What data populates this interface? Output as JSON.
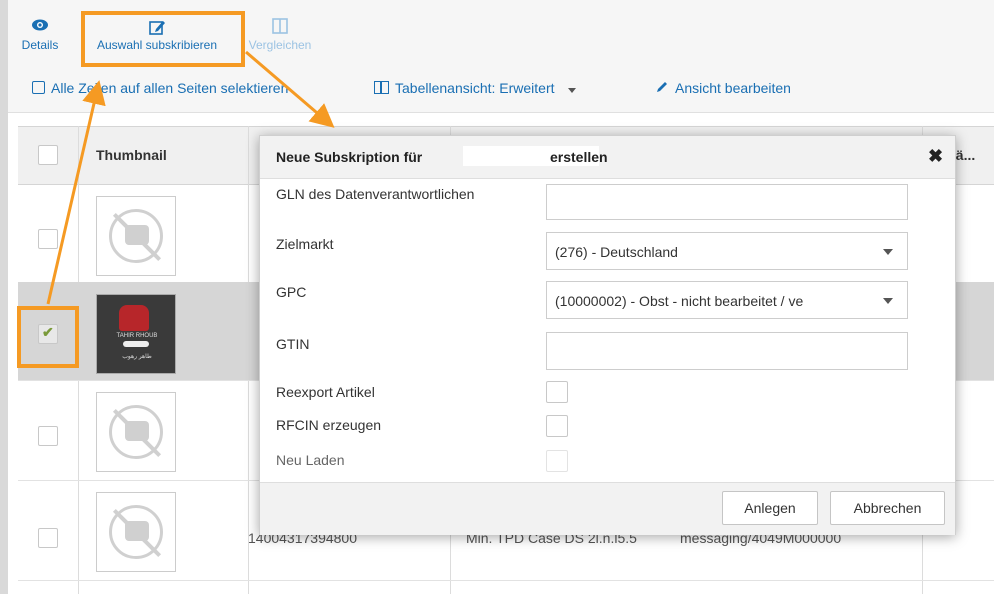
{
  "toolbar": {
    "details_label": "Details",
    "subscribe_label": "Auswahl subskribieren",
    "compare_label": "Vergleichen",
    "select_all_label": "Alle Zeilen auf allen Seiten selektieren",
    "table_view_label": "Tabellenansicht: Erweitert",
    "edit_view_label": "Ansicht bearbeiten"
  },
  "table": {
    "thumbnail_header": "Thumbnail",
    "last_header": "sä...",
    "row_partial": [
      "14004317394800",
      "Min. TPD Case DS 2l.n.l5.5",
      "messaging/4049M000000"
    ],
    "rows": [
      {
        "checked": false,
        "thumb": "placeholder"
      },
      {
        "checked": true,
        "thumb": "image",
        "thumb_text_1": "TAHIR RHOUB",
        "thumb_text_2": "طاهر رهوب"
      },
      {
        "checked": false,
        "thumb": "placeholder"
      },
      {
        "checked": false,
        "thumb": "placeholder"
      }
    ]
  },
  "dialog": {
    "title_prefix": "Neue Subskription für",
    "title_suffix": "erstellen",
    "close_symbol": "✖",
    "fields": {
      "gln_label": "GLN des Datenverantwortlichen",
      "gln_value": "",
      "target_market_label": "Zielmarkt",
      "target_market_value": "(276) - Deutschland",
      "gpc_label": "GPC",
      "gpc_value": "(10000002) - Obst - nicht bearbeitet / ve",
      "gtin_label": "GTIN",
      "gtin_value": "",
      "reexport_label": "Reexport Artikel",
      "rfcin_label": "RFCIN erzeugen",
      "reload_label": "Neu Laden"
    },
    "create_button": "Anlegen",
    "cancel_button": "Abbrechen"
  },
  "colors": {
    "accent": "#1a6fb3",
    "highlight": "#f59a23"
  },
  "icons": [
    "eye-icon",
    "edit-icon",
    "compare-icon",
    "checkbox-icon",
    "table-icon",
    "pencil-icon",
    "chevron-down-icon",
    "close-icon",
    "check-icon",
    "no-image-icon"
  ]
}
